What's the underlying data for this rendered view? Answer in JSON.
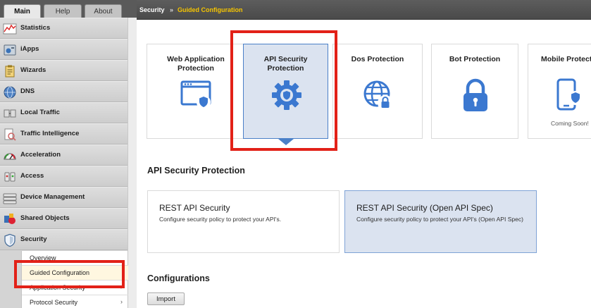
{
  "nav_tabs": {
    "main": "Main",
    "help": "Help",
    "about": "About"
  },
  "nav_items": [
    {
      "label": "Statistics",
      "icon": "statistics-chart-icon"
    },
    {
      "label": "iApps",
      "icon": "iapps-icon"
    },
    {
      "label": "Wizards",
      "icon": "wizards-clipboard-icon"
    },
    {
      "label": "DNS",
      "icon": "dns-globe-icon"
    },
    {
      "label": "Local Traffic",
      "icon": "local-traffic-icon"
    },
    {
      "label": "Traffic Intelligence",
      "icon": "traffic-intelligence-icon"
    },
    {
      "label": "Acceleration",
      "icon": "acceleration-gauge-icon"
    },
    {
      "label": "Access",
      "icon": "access-icon"
    },
    {
      "label": "Device Management",
      "icon": "device-management-icon"
    },
    {
      "label": "Shared Objects",
      "icon": "shared-objects-icon"
    },
    {
      "label": "Security",
      "icon": "security-shield-icon"
    }
  ],
  "security_submenu": [
    {
      "label": "Overview"
    },
    {
      "label": "Guided Configuration",
      "active": true
    },
    {
      "label": "Application Security"
    },
    {
      "label": "Protocol Security"
    }
  ],
  "breadcrumb": {
    "section": "Security",
    "separator": "»",
    "page": "Guided Configuration"
  },
  "service_cards": [
    {
      "title": "Web Application Protection",
      "icon": "web-app-shield-icon"
    },
    {
      "title": "API Security Protection",
      "icon": "gear-shield-icon",
      "selected": true
    },
    {
      "title": "Dos Protection",
      "icon": "globe-lock-icon"
    },
    {
      "title": "Bot Protection",
      "icon": "padlock-icon"
    },
    {
      "title": "Mobile Protect",
      "icon": "mobile-shield-icon",
      "note": "Coming Soon!"
    }
  ],
  "section_title": "API Security Protection",
  "policy_cards": [
    {
      "title": "REST API Security",
      "description": "Configure security policy to protect your API's."
    },
    {
      "title": "REST API Security (Open API Spec)",
      "description": "Configure security policy to protect your API's (Open API Spec)",
      "selected": true
    }
  ],
  "configurations": {
    "title": "Configurations",
    "import_label": "Import"
  },
  "colors": {
    "accent_blue": "#4a80c8",
    "selected_bg": "#dbe3f0",
    "highlight_red": "#e22118",
    "breadcrumb_page": "#f5c400",
    "titlebar": "#505050"
  }
}
